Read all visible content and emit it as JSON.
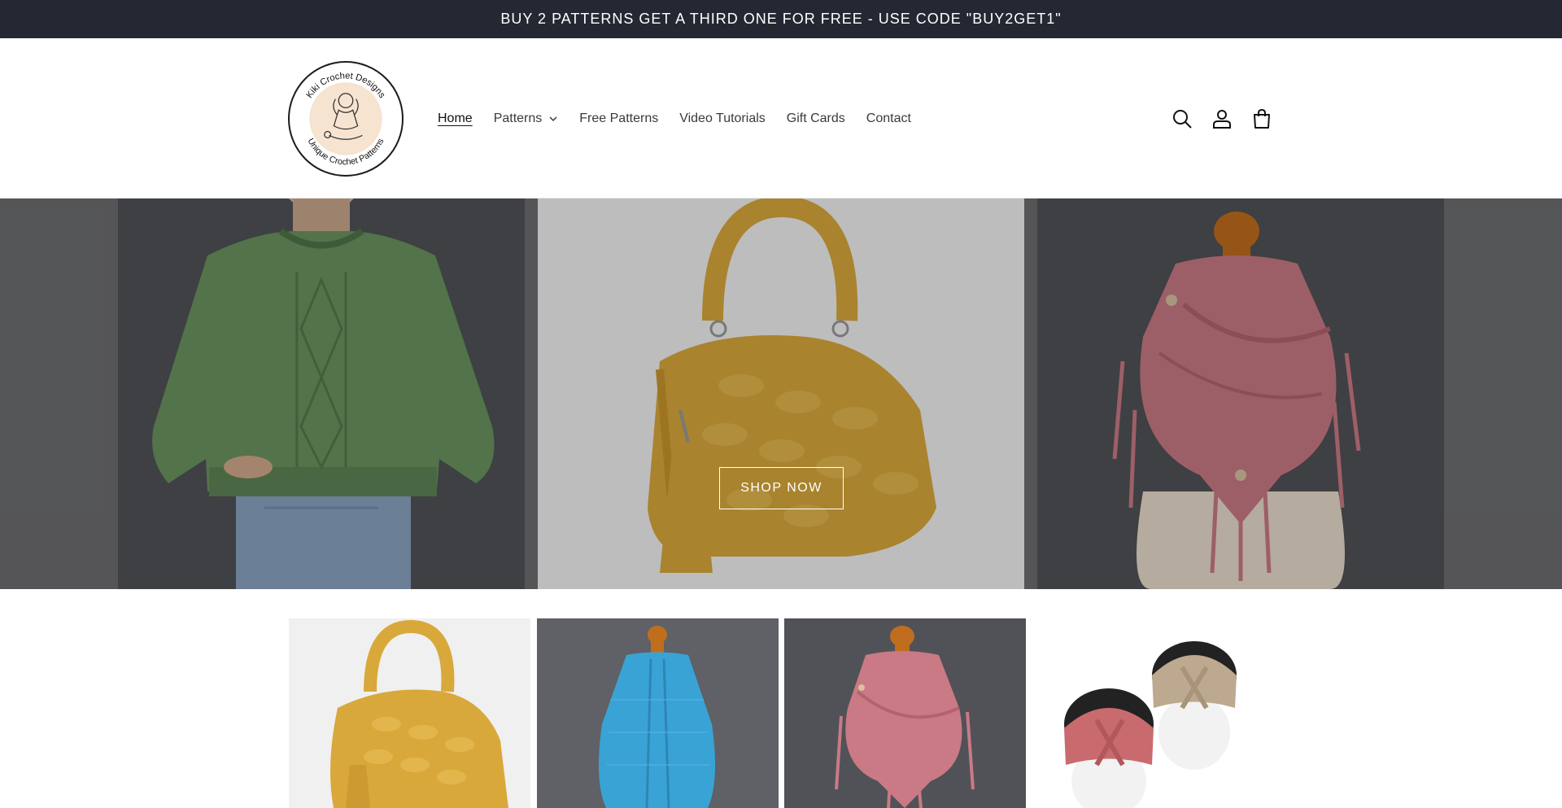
{
  "announcement": {
    "text": "BUY 2 PATTERNS GET A THIRD ONE FOR FREE - USE CODE \"BUY2GET1\""
  },
  "header": {
    "logo": {
      "top_text": "Kiki Crochet Designs",
      "bottom_text": "Unique Crochet Patterns"
    },
    "nav": {
      "home": "Home",
      "patterns": "Patterns",
      "free_patterns": "Free Patterns",
      "video_tutorials": "Video Tutorials",
      "gift_cards": "Gift Cards",
      "contact": "Contact"
    },
    "icons": [
      "search-icon",
      "account-icon",
      "cart-icon"
    ]
  },
  "hero": {
    "button_label": "SHOP NOW",
    "slides": [
      "green-sweater",
      "yellow-bag",
      "pink-scarf"
    ]
  },
  "products": [
    "yellow-bag",
    "blue-shawl",
    "pink-scarf",
    "twist-headbands"
  ],
  "colors": {
    "announcement_bg": "#242833",
    "sweater": "#6b9461",
    "bag": "#d9a83b",
    "scarf": "#c97a85",
    "shawl": "#3aa3d6",
    "headband_pink": "#c96a6f",
    "headband_beige": "#bda98f"
  }
}
